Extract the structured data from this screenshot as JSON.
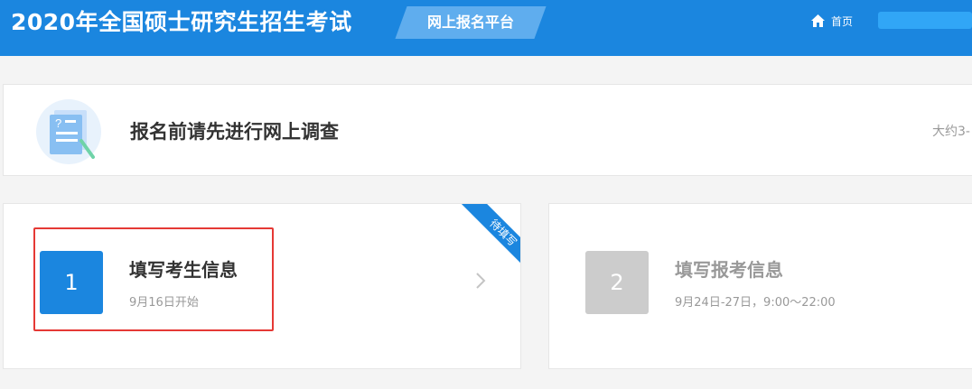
{
  "header": {
    "title": "2020年全国硕士研究生招生考试",
    "platform_label": "网上报名平台",
    "home_label": "首页",
    "colors": {
      "brand": "#1b86df",
      "tag": "#5fadee"
    }
  },
  "survey": {
    "icon": "survey-document-icon",
    "title": "报名前请先进行网上调查",
    "note": "大约3-"
  },
  "steps": [
    {
      "number": "1",
      "title": "填写考生信息",
      "date": "9月16日开始",
      "ribbon": "待填写",
      "status_color": "#1b86df"
    },
    {
      "number": "2",
      "title": "填写报考信息",
      "date": "9月24日-27日，9:00～22:00",
      "status_color": "#cccccc"
    }
  ]
}
